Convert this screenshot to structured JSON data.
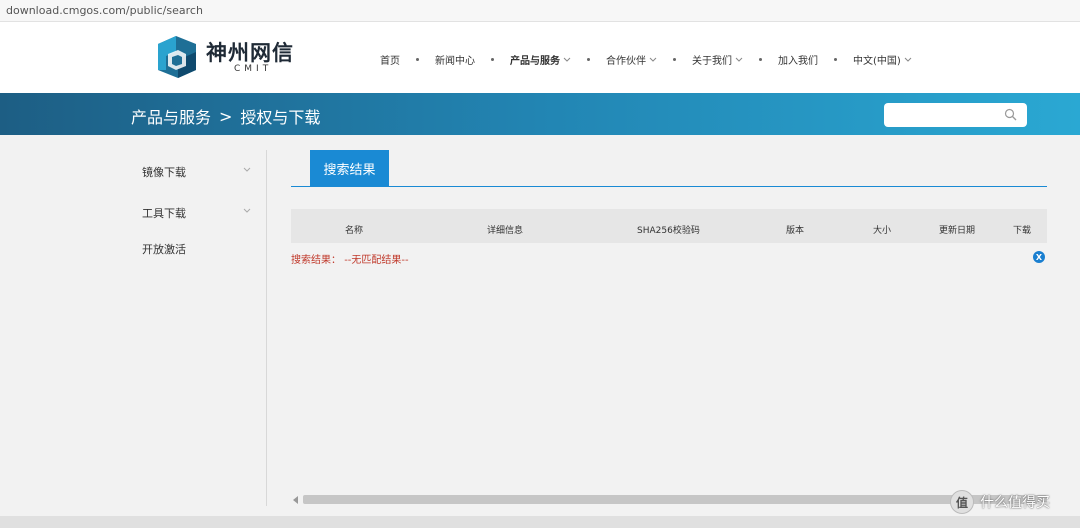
{
  "browser": {
    "url": "download.cmgos.com/public/search"
  },
  "logo": {
    "cn": "神州网信",
    "en": "CMIT"
  },
  "nav": {
    "items": [
      {
        "label": "首页",
        "has_dropdown": false,
        "bold": false
      },
      {
        "label": "新闻中心",
        "has_dropdown": false,
        "bold": false
      },
      {
        "label": "产品与服务",
        "has_dropdown": true,
        "bold": true
      },
      {
        "label": "合作伙伴",
        "has_dropdown": true,
        "bold": false
      },
      {
        "label": "关于我们",
        "has_dropdown": true,
        "bold": false
      },
      {
        "label": "加入我们",
        "has_dropdown": false,
        "bold": false
      },
      {
        "label": "中文(中国)",
        "has_dropdown": true,
        "bold": false
      }
    ]
  },
  "banner": {
    "breadcrumb": [
      "产品与服务",
      "授权与下载"
    ],
    "separator": ">",
    "search_placeholder": ""
  },
  "sidebar": {
    "items": [
      {
        "label": "镜像下载",
        "has_dropdown": true
      },
      {
        "label": "工具下载",
        "has_dropdown": true
      },
      {
        "label": "开放激活",
        "has_dropdown": false
      }
    ]
  },
  "main": {
    "tab": "搜索结果",
    "columns": [
      "名称",
      "详细信息",
      "SHA256校验码",
      "版本",
      "大小",
      "更新日期",
      "下载"
    ],
    "result_label": "搜索结果：",
    "result_value": "--无匹配结果--",
    "close_label": "X"
  },
  "watermark": {
    "badge": "值",
    "text": "什么值得买"
  },
  "colors": {
    "accent": "#1a8ad4",
    "banner_start": "#1d5e84",
    "banner_end": "#2aa8d3",
    "error": "#c0392b"
  }
}
